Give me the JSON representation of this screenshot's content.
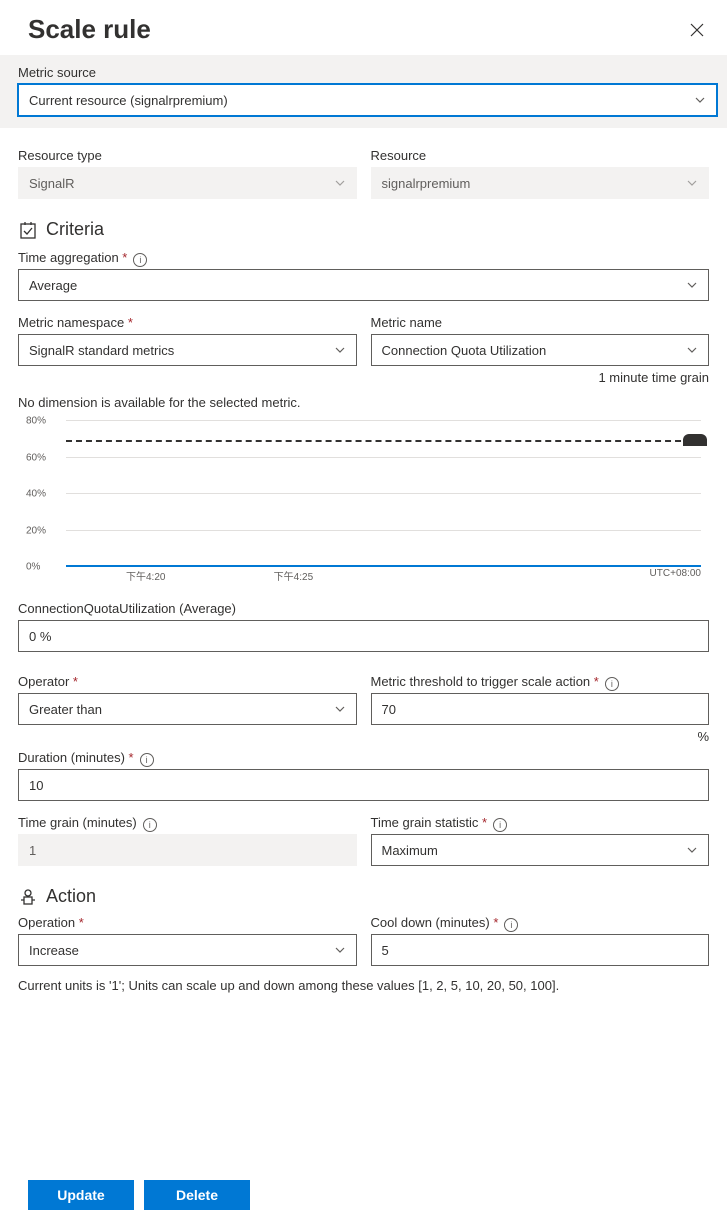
{
  "header": {
    "title": "Scale rule"
  },
  "metric_source": {
    "label": "Metric source",
    "value": "Current resource (signalrpremium)"
  },
  "resource_type": {
    "label": "Resource type",
    "value": "SignalR"
  },
  "resource": {
    "label": "Resource",
    "value": "signalrpremium"
  },
  "criteria": {
    "title": "Criteria"
  },
  "time_aggregation": {
    "label": "Time aggregation",
    "value": "Average"
  },
  "metric_namespace": {
    "label": "Metric namespace",
    "value": "SignalR standard metrics"
  },
  "metric_name": {
    "label": "Metric name",
    "value": "Connection Quota Utilization"
  },
  "time_grain_hint": "1 minute time grain",
  "dimension_message": "No dimension is available for the selected metric.",
  "chart_data": {
    "type": "line",
    "series": [
      {
        "name": "ConnectionQuotaUtilization (Average)",
        "values": [
          0,
          0,
          0,
          0,
          0,
          0,
          0,
          0,
          0,
          0
        ]
      }
    ],
    "ylabel": "",
    "ylim": [
      0,
      80
    ],
    "y_ticks": [
      "80%",
      "60%",
      "40%",
      "20%",
      "0%"
    ],
    "x_ticks": [
      "下午4:20",
      "下午4:25"
    ],
    "timezone": "UTC+08:00",
    "threshold": 70
  },
  "metric_value": {
    "label": "ConnectionQuotaUtilization (Average)",
    "value": "0 %"
  },
  "operator": {
    "label": "Operator",
    "value": "Greater than"
  },
  "threshold": {
    "label": "Metric threshold to trigger scale action",
    "value": "70",
    "suffix": "%"
  },
  "duration": {
    "label": "Duration (minutes)",
    "value": "10"
  },
  "time_grain": {
    "label": "Time grain (minutes)",
    "value": "1"
  },
  "time_grain_statistic": {
    "label": "Time grain statistic",
    "value": "Maximum"
  },
  "action": {
    "title": "Action"
  },
  "operation": {
    "label": "Operation",
    "value": "Increase"
  },
  "cooldown": {
    "label": "Cool down (minutes)",
    "value": "5"
  },
  "units_note": "Current units is '1'; Units can scale up and down among these values [1, 2, 5, 10, 20, 50, 100].",
  "buttons": {
    "update": "Update",
    "delete": "Delete"
  }
}
